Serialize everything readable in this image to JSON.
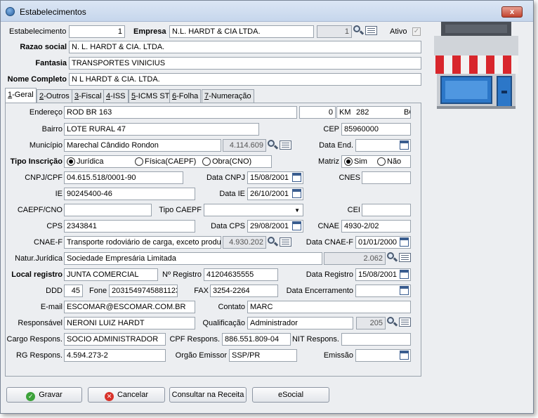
{
  "window": {
    "title": "Estabelecimentos",
    "close_label": "x"
  },
  "header": {
    "estabelecimento_label": "Estabelecimento",
    "estabelecimento_value": "1",
    "empresa_label": "Empresa",
    "empresa_value": "N.L. HARDT & CIA LTDA.",
    "empresa_code": "1",
    "ativo_label": "Ativo",
    "ativo_mark": "✓",
    "razao_label": "Razao social",
    "razao_value": "N. L. HARDT & CIA. LTDA.",
    "fantasia_label": "Fantasia",
    "fantasia_value": "TRANSPORTES VINICIUS",
    "nome_label": "Nome Completo",
    "nome_value": "N L HARDT & CIA. LTDA."
  },
  "tabs": [
    {
      "key": "1",
      "label": "-Geral"
    },
    {
      "key": "2",
      "label": "-Outros"
    },
    {
      "key": "3",
      "label": "-Fiscal"
    },
    {
      "key": "4",
      "label": "-ISS"
    },
    {
      "key": "5",
      "label": "-ICMS ST"
    },
    {
      "key": "6",
      "label": "-Folha"
    },
    {
      "key": "7",
      "label": "-Numeração"
    }
  ],
  "geral": {
    "endereco_label": "Endereço",
    "endereco_value": "ROD BR 163",
    "numero_value": "0",
    "km_label": "KM",
    "km_value": "282",
    "complemento_value": "BO",
    "bairro_label": "Bairro",
    "bairro_value": "LOTE RURAL 47",
    "cep_label": "CEP",
    "cep_value": "85960000",
    "municipio_label": "Município",
    "municipio_value": "Marechal Cândido Rondon",
    "municipio_code": "4.114.609",
    "data_end_label": "Data End.",
    "data_end_value": "",
    "tipo_insc_label": "Tipo Inscrição",
    "tipo_juridica": "Jurídica",
    "tipo_fisica": "Física(CAEPF)",
    "tipo_obra": "Obra(CNO)",
    "matriz_label": "Matriz",
    "matriz_sim": "Sim",
    "matriz_nao": "Não",
    "cnpj_label": "CNPJ/CPF",
    "cnpj_value": "04.615.518/0001-90",
    "data_cnpj_label": "Data CNPJ",
    "data_cnpj_value": "15/08/2001",
    "cnes_label": "CNES",
    "cnes_value": "",
    "ie_label": "IE",
    "ie_value": "90245400-46",
    "data_ie_label": "Data IE",
    "data_ie_value": "26/10/2001",
    "caepf_label": "CAEPF/CNO",
    "caepf_value": "",
    "tipo_caepf_label": "Tipo CAEPF",
    "tipo_caepf_value": "",
    "cei_label": "CEI",
    "cei_value": "",
    "cps_label": "CPS",
    "cps_value": "2343841",
    "data_cps_label": "Data CPS",
    "data_cps_value": "29/08/2001",
    "cnae_label": "CNAE",
    "cnae_value": "4930-2/02",
    "cnaef_label": "CNAE-F",
    "cnaef_value": "Transporte rodoviário de carga, exceto produ",
    "cnaef_code": "4.930.202",
    "data_cnaef_label": "Data CNAE-F",
    "data_cnaef_value": "01/01/2000",
    "natur_label": "Natur.Jurídica",
    "natur_value": "Sociedade Empresária Limitada",
    "natur_code": "2.062",
    "local_reg_label": "Local registro",
    "local_reg_value": "JUNTA COMERCIAL",
    "nregistro_label": "Nº Registro",
    "nregistro_value": "41204635555",
    "data_reg_label": "Data Registro",
    "data_reg_value": "15/08/2001",
    "ddd_label": "DDD",
    "ddd_value": "45",
    "fone_label": "Fone",
    "fone_value": "2031549745881123",
    "fax_label": "FAX",
    "fax_value": "3254-2264",
    "data_enc_label": "Data Encerramento",
    "data_enc_value": "",
    "email_label": "E-mail",
    "email_value": "ESCOMAR@ESCOMAR.COM.BR",
    "contato_label": "Contato",
    "contato_value": "MARC",
    "resp_label": "Responsável",
    "resp_value": "NERONI LUIZ HARDT",
    "qualif_label": "Qualificação",
    "qualif_value": "Administrador",
    "qualif_code": "205",
    "cargo_label": "Cargo Respons.",
    "cargo_value": "SOCIO ADMINISTRADOR",
    "cpf_resp_label": "CPF Respons.",
    "cpf_resp_value": "886.551.809-04",
    "nit_label": "NIT Respons.",
    "nit_value": "",
    "rg_label": "RG Respons.",
    "rg_value": "4.594.273-2",
    "orgao_label": "Orgão Emissor",
    "orgao_value": "SSP/PR",
    "emissao_label": "Emissão",
    "emissao_value": ""
  },
  "footer": {
    "gravar_label": "Gravar",
    "cancelar_label": "Cancelar",
    "consultar_label": "Consultar na Receita",
    "esocial_label": "eSocial"
  },
  "colors": {
    "title_bar": "#c6d6ec",
    "close_button": "#c1432e",
    "window_bg": "#eceef1"
  }
}
